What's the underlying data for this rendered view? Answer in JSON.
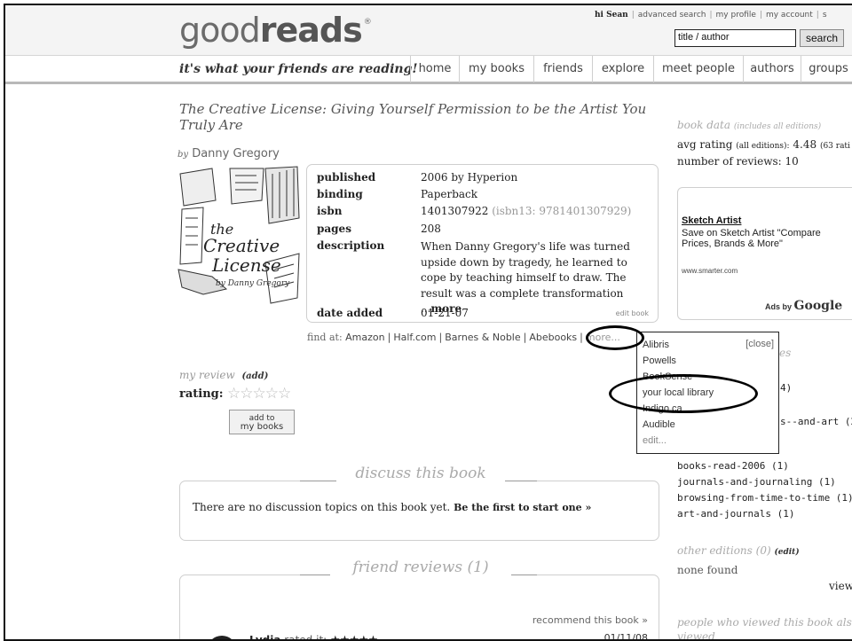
{
  "header": {
    "logo_light": "good",
    "logo_bold": "reads",
    "logo_mark": "®",
    "greeting": "hi Sean",
    "top_links": [
      "advanced search",
      "my profile",
      "my account",
      "s"
    ],
    "search_value": "title / author",
    "search_button": "search"
  },
  "nav": {
    "tagline": "it's what your friends are reading!",
    "tabs": [
      "home",
      "my books",
      "friends",
      "explore",
      "meet people",
      "authors",
      "groups"
    ]
  },
  "book": {
    "title": "The Creative License: Giving Yourself Permission to be the Artist You Truly Are",
    "by_label": "by",
    "author": "Danny Gregory",
    "details": {
      "published_label": "published",
      "published_value": "2006 by Hyperion",
      "binding_label": "binding",
      "binding_value": "Paperback",
      "isbn_label": "isbn",
      "isbn_value": "1401307922",
      "isbn13_value": "(isbn13: 9781401307929)",
      "pages_label": "pages",
      "pages_value": "208",
      "description_label": "description",
      "description_value": "When Danny Gregory's life was turned upside down by tragedy, he learned to cope by teaching himself to draw. The result was a complete transformation ...",
      "description_more": "more",
      "date_added_label": "date added",
      "date_added_value": "01-21-07",
      "edit_book": "edit book"
    },
    "find_at_label": "find at:",
    "find_at": [
      "Amazon",
      "Half.com",
      "Barnes & Noble",
      "Abebooks"
    ],
    "find_more": "more..."
  },
  "my_review": {
    "label": "my review",
    "add": "(add)",
    "rating_label": "rating:",
    "empty_stars": "☆☆☆☆☆",
    "add_button_line1": "add to",
    "add_button_line2": "my books"
  },
  "discuss": {
    "heading": "discuss this book",
    "text": "There are no discussion topics on this book yet.",
    "cta": "Be the first to start one »"
  },
  "friend_reviews": {
    "heading": "friend reviews (1)",
    "recommend": "recommend this book »",
    "reviewer": "Lydia",
    "rated_text": "rated it:",
    "stars": "★★★★★",
    "date": "01/11/08"
  },
  "sidebar": {
    "book_data_label": "book data",
    "book_data_note": "(includes all editions)",
    "avg_rating_label": "avg rating",
    "avg_rating_note": "(all editions):",
    "avg_rating_value": "4.48",
    "ratings_note": "(63 rati",
    "reviews_label": "number of reviews:",
    "reviews_value": "10",
    "ad": {
      "title": "Sketch Artist",
      "body": "Save on Sketch Artist \"Compare Prices, Brands & More\"",
      "url": "www.smarter.com",
      "ads_by": "Ads by",
      "google": "Google"
    },
    "shelves_partial_1": "es",
    "shelves_partial_2": "4)",
    "shelves_partial_3": "s--and-art (2)",
    "shelves": [
      "books-read-2006 (1)",
      "journals-and-journaling (1)",
      "browsing-from-time-to-time (1)",
      "art-and-journals (1)"
    ],
    "other_editions_label": "other editions (0)",
    "other_editions_edit": "(edit)",
    "none_found": "none found",
    "view": "view",
    "people_viewed": "people who viewed this book als",
    "people_viewed_2": "viewed"
  },
  "popup": {
    "close": "[close]",
    "items": [
      "Alibris",
      "Powells",
      "BookSense",
      "your local library",
      "Indigo.ca",
      "Audible"
    ],
    "edit": "edit..."
  }
}
